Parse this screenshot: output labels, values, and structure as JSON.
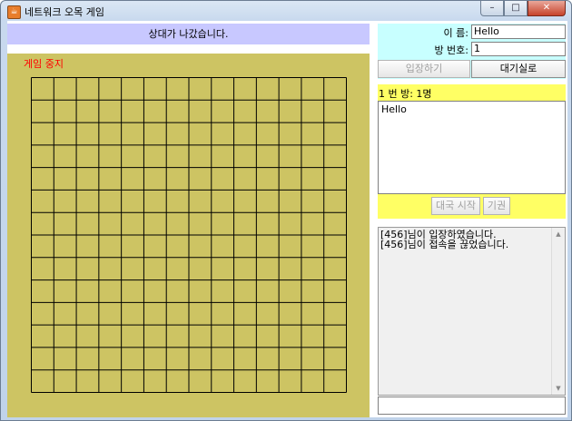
{
  "window": {
    "title": "네트워크 오목 게임"
  },
  "status": {
    "message": "상대가 나갔습니다."
  },
  "game": {
    "state_label": "게임 중지",
    "grid_lines": 15
  },
  "info": {
    "name_label": "이     름:",
    "name_value": "Hello",
    "room_label": "방 번호:",
    "room_value": "1",
    "enter_button": "입장하기",
    "lobby_button": "대기실로"
  },
  "room": {
    "title": "1 번 방: 1명",
    "users": [
      "Hello"
    ],
    "start_button": "대국 시작",
    "resign_button": "기권"
  },
  "chat": {
    "lines": [
      "[456]님이 입장하였습니다.",
      "[456]님이 접속을 끊었습니다."
    ]
  },
  "colors": {
    "status_bg": "#c8c8ff",
    "board_bg": "#cdc463",
    "info_bg": "#c8ffff",
    "room_bg": "#ffff64",
    "state_text": "#ff0000"
  }
}
